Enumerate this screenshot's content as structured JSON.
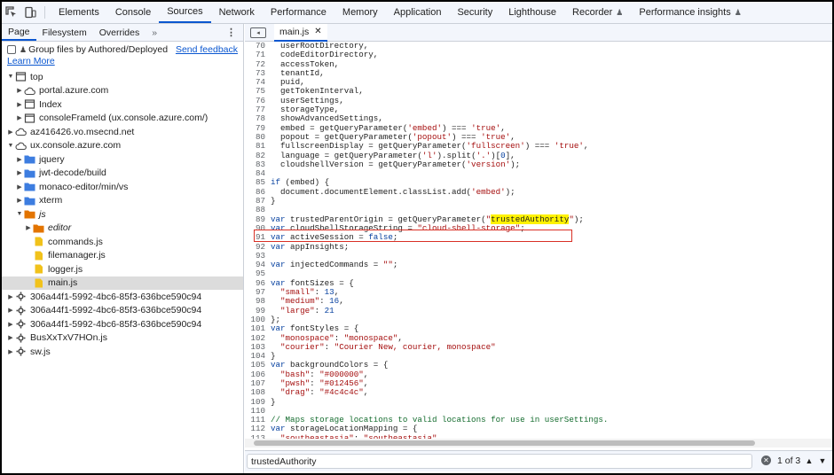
{
  "topbar": {
    "tabs": [
      "Elements",
      "Console",
      "Sources",
      "Network",
      "Performance",
      "Memory",
      "Application",
      "Security",
      "Lighthouse",
      "Recorder",
      "Performance insights"
    ],
    "active_tab": "Sources",
    "experimental_tabs": [
      "Recorder",
      "Performance insights"
    ]
  },
  "sidebar": {
    "subtabs": [
      "Page",
      "Filesystem",
      "Overrides"
    ],
    "more": "»",
    "group_label": "Group files by Authored/Deployed",
    "send_feedback": "Send feedback",
    "learn_more": "Learn More",
    "tree": [
      {
        "label": "top",
        "indent": 0,
        "arrow": "down",
        "icon": "frame-icon"
      },
      {
        "label": "portal.azure.com",
        "indent": 1,
        "arrow": "right",
        "icon": "cloud-icon"
      },
      {
        "label": "Index",
        "indent": 1,
        "arrow": "right",
        "icon": "frame-icon"
      },
      {
        "label": "consoleFrameId (ux.console.azure.com/)",
        "indent": 1,
        "arrow": "right",
        "icon": "frame-icon"
      },
      {
        "label": "az416426.vo.msecnd.net",
        "indent": 0,
        "arrow": "right",
        "icon": "cloud-icon"
      },
      {
        "label": "ux.console.azure.com",
        "indent": 0,
        "arrow": "down",
        "icon": "cloud-icon"
      },
      {
        "label": "jquery",
        "indent": 1,
        "arrow": "right",
        "icon": "folder-blue-icon"
      },
      {
        "label": "jwt-decode/build",
        "indent": 1,
        "arrow": "right",
        "icon": "folder-blue-icon"
      },
      {
        "label": "monaco-editor/min/vs",
        "indent": 1,
        "arrow": "right",
        "icon": "folder-blue-icon"
      },
      {
        "label": "xterm",
        "indent": 1,
        "arrow": "right",
        "icon": "folder-blue-icon"
      },
      {
        "label": "js",
        "indent": 1,
        "arrow": "down",
        "icon": "folder-orange-icon",
        "italic": true
      },
      {
        "label": "editor",
        "indent": 2,
        "arrow": "right",
        "icon": "folder-orange-icon",
        "italic": true
      },
      {
        "label": "commands.js",
        "indent": 2,
        "arrow": "",
        "icon": "js-file-icon"
      },
      {
        "label": "filemanager.js",
        "indent": 2,
        "arrow": "",
        "icon": "js-file-icon"
      },
      {
        "label": "logger.js",
        "indent": 2,
        "arrow": "",
        "icon": "js-file-icon"
      },
      {
        "label": "main.js",
        "indent": 2,
        "arrow": "",
        "icon": "js-file-icon",
        "selected": true
      },
      {
        "label": "306a44f1-5992-4bc6-85f3-636bce590c94",
        "indent": 0,
        "arrow": "right",
        "icon": "gear-icon"
      },
      {
        "label": "306a44f1-5992-4bc6-85f3-636bce590c94",
        "indent": 0,
        "arrow": "right",
        "icon": "gear-icon"
      },
      {
        "label": "306a44f1-5992-4bc6-85f3-636bce590c94",
        "indent": 0,
        "arrow": "right",
        "icon": "gear-icon"
      },
      {
        "label": "BusXxTxV7HOn.js",
        "indent": 0,
        "arrow": "right",
        "icon": "gear-icon"
      },
      {
        "label": "sw.js",
        "indent": 0,
        "arrow": "right",
        "icon": "gear-icon"
      }
    ]
  },
  "editor": {
    "file_tab": "main.js",
    "lines": [
      {
        "n": "70",
        "t": [
          [
            "",
            "  userRootDirectory,"
          ]
        ]
      },
      {
        "n": "71",
        "t": [
          [
            "",
            "  codeEditorDirectory,"
          ]
        ]
      },
      {
        "n": "72",
        "t": [
          [
            "",
            "  accessToken,"
          ]
        ]
      },
      {
        "n": "73",
        "t": [
          [
            "",
            "  tenantId,"
          ]
        ]
      },
      {
        "n": "74",
        "t": [
          [
            "",
            "  puid,"
          ]
        ]
      },
      {
        "n": "75",
        "t": [
          [
            "",
            "  getTokenInterval,"
          ]
        ]
      },
      {
        "n": "76",
        "t": [
          [
            "",
            "  userSettings,"
          ]
        ]
      },
      {
        "n": "77",
        "t": [
          [
            "",
            "  storageType,"
          ]
        ]
      },
      {
        "n": "78",
        "t": [
          [
            "",
            "  showAdvancedSettings,"
          ]
        ]
      },
      {
        "n": "79",
        "t": [
          [
            "",
            "  embed = getQueryParameter("
          ],
          [
            "str",
            "'embed'"
          ],
          [
            "",
            ") === "
          ],
          [
            "str",
            "'true'"
          ],
          [
            "",
            ","
          ]
        ]
      },
      {
        "n": "80",
        "t": [
          [
            "",
            "  popout = getQueryParameter("
          ],
          [
            "str",
            "'popout'"
          ],
          [
            "",
            ") === "
          ],
          [
            "str",
            "'true'"
          ],
          [
            "",
            ","
          ]
        ]
      },
      {
        "n": "81",
        "t": [
          [
            "",
            "  fullscreenDisplay = getQueryParameter("
          ],
          [
            "str",
            "'fullscreen'"
          ],
          [
            "",
            ") === "
          ],
          [
            "str",
            "'true'"
          ],
          [
            "",
            ","
          ]
        ]
      },
      {
        "n": "82",
        "t": [
          [
            "",
            "  language = getQueryParameter("
          ],
          [
            "str",
            "'l'"
          ],
          [
            "",
            ").split("
          ],
          [
            "str",
            "'.'"
          ],
          [
            "",
            ")["
          ],
          [
            "num",
            "0"
          ],
          [
            "",
            "],"
          ]
        ]
      },
      {
        "n": "83",
        "t": [
          [
            "",
            "  cloudshellVersion = getQueryParameter("
          ],
          [
            "str",
            "'version'"
          ],
          [
            "",
            ");"
          ]
        ]
      },
      {
        "n": "84",
        "t": [
          [
            "",
            ""
          ]
        ]
      },
      {
        "n": "85",
        "t": [
          [
            "kw",
            "if"
          ],
          [
            "",
            " (embed) {"
          ]
        ]
      },
      {
        "n": "86",
        "t": [
          [
            "",
            "  document.documentElement.classList.add("
          ],
          [
            "str",
            "'embed'"
          ],
          [
            "",
            ");"
          ]
        ]
      },
      {
        "n": "87",
        "t": [
          [
            "",
            "}"
          ]
        ]
      },
      {
        "n": "88",
        "t": [
          [
            "",
            ""
          ]
        ]
      },
      {
        "n": "89",
        "t": [
          [
            "kw",
            "var"
          ],
          [
            "",
            " trustedParentOrigin = getQueryParameter("
          ],
          [
            "str",
            "\""
          ],
          [
            "hl",
            "trustedAuthority"
          ],
          [
            "str",
            "\""
          ],
          [
            "",
            ");"
          ]
        ]
      },
      {
        "n": "90",
        "t": [
          [
            "kw",
            "var"
          ],
          [
            "",
            " cloudShellStorageString = "
          ],
          [
            "str",
            "\"cloud-shell-storage\""
          ],
          [
            "",
            ";"
          ]
        ]
      },
      {
        "n": "91",
        "t": [
          [
            "kw",
            "var"
          ],
          [
            "",
            " activeSession = "
          ],
          [
            "kw",
            "false"
          ],
          [
            "",
            ";"
          ]
        ]
      },
      {
        "n": "92",
        "t": [
          [
            "kw",
            "var"
          ],
          [
            "",
            " appInsights;"
          ]
        ]
      },
      {
        "n": "93",
        "t": [
          [
            "",
            ""
          ]
        ]
      },
      {
        "n": "94",
        "t": [
          [
            "kw",
            "var"
          ],
          [
            "",
            " injectedCommands = "
          ],
          [
            "str",
            "\"\""
          ],
          [
            "",
            ";"
          ]
        ]
      },
      {
        "n": "95",
        "t": [
          [
            "",
            ""
          ]
        ]
      },
      {
        "n": "96",
        "t": [
          [
            "kw",
            "var"
          ],
          [
            "",
            " fontSizes = {"
          ]
        ]
      },
      {
        "n": "97",
        "t": [
          [
            "",
            "  "
          ],
          [
            "str",
            "\"small\""
          ],
          [
            "",
            ": "
          ],
          [
            "num",
            "13"
          ],
          [
            "",
            ","
          ]
        ]
      },
      {
        "n": "98",
        "t": [
          [
            "",
            "  "
          ],
          [
            "str",
            "\"medium\""
          ],
          [
            "",
            ": "
          ],
          [
            "num",
            "16"
          ],
          [
            "",
            ","
          ]
        ]
      },
      {
        "n": "99",
        "t": [
          [
            "",
            "  "
          ],
          [
            "str",
            "\"large\""
          ],
          [
            "",
            ": "
          ],
          [
            "num",
            "21"
          ]
        ]
      },
      {
        "n": "100",
        "t": [
          [
            "",
            "};"
          ]
        ]
      },
      {
        "n": "101",
        "t": [
          [
            "kw",
            "var"
          ],
          [
            "",
            " fontStyles = {"
          ]
        ]
      },
      {
        "n": "102",
        "t": [
          [
            "",
            "  "
          ],
          [
            "str",
            "\"monospace\""
          ],
          [
            "",
            ": "
          ],
          [
            "str",
            "\"monospace\""
          ],
          [
            "",
            ","
          ]
        ]
      },
      {
        "n": "103",
        "t": [
          [
            "",
            "  "
          ],
          [
            "str",
            "\"courier\""
          ],
          [
            "",
            ": "
          ],
          [
            "str",
            "\"Courier New, courier, monospace\""
          ]
        ]
      },
      {
        "n": "104",
        "t": [
          [
            "",
            "}"
          ]
        ]
      },
      {
        "n": "105",
        "t": [
          [
            "kw",
            "var"
          ],
          [
            "",
            " backgroundColors = {"
          ]
        ]
      },
      {
        "n": "106",
        "t": [
          [
            "",
            "  "
          ],
          [
            "str",
            "\"bash\""
          ],
          [
            "",
            ": "
          ],
          [
            "str",
            "\"#000000\""
          ],
          [
            "",
            ","
          ]
        ]
      },
      {
        "n": "107",
        "t": [
          [
            "",
            "  "
          ],
          [
            "str",
            "\"pwsh\""
          ],
          [
            "",
            ": "
          ],
          [
            "str",
            "\"#012456\""
          ],
          [
            "",
            ","
          ]
        ]
      },
      {
        "n": "108",
        "t": [
          [
            "",
            "  "
          ],
          [
            "str",
            "\"drag\""
          ],
          [
            "",
            ": "
          ],
          [
            "str",
            "\"#4c4c4c\""
          ],
          [
            "",
            ","
          ]
        ]
      },
      {
        "n": "109",
        "t": [
          [
            "",
            "}"
          ]
        ]
      },
      {
        "n": "110",
        "t": [
          [
            "",
            ""
          ]
        ]
      },
      {
        "n": "111",
        "t": [
          [
            "cm",
            "// Maps storage locations to valid locations for use in userSettings."
          ]
        ]
      },
      {
        "n": "112",
        "t": [
          [
            "kw",
            "var"
          ],
          [
            "",
            " storageLocationMapping = {"
          ]
        ]
      },
      {
        "n": "113",
        "t": [
          [
            "",
            "  "
          ],
          [
            "str",
            "\"southeastasia\""
          ],
          [
            "",
            ": "
          ],
          [
            "str",
            "\"southeastasia\""
          ],
          [
            "",
            ","
          ]
        ]
      }
    ]
  },
  "search": {
    "query": "trustedAuthority",
    "count": "1 of 3",
    "up": "▲",
    "down": "▼",
    "clear": "✕"
  },
  "colors": {
    "accent": "#0b57d0",
    "highlight": "#fff200",
    "annotation_box": "#d93025"
  }
}
